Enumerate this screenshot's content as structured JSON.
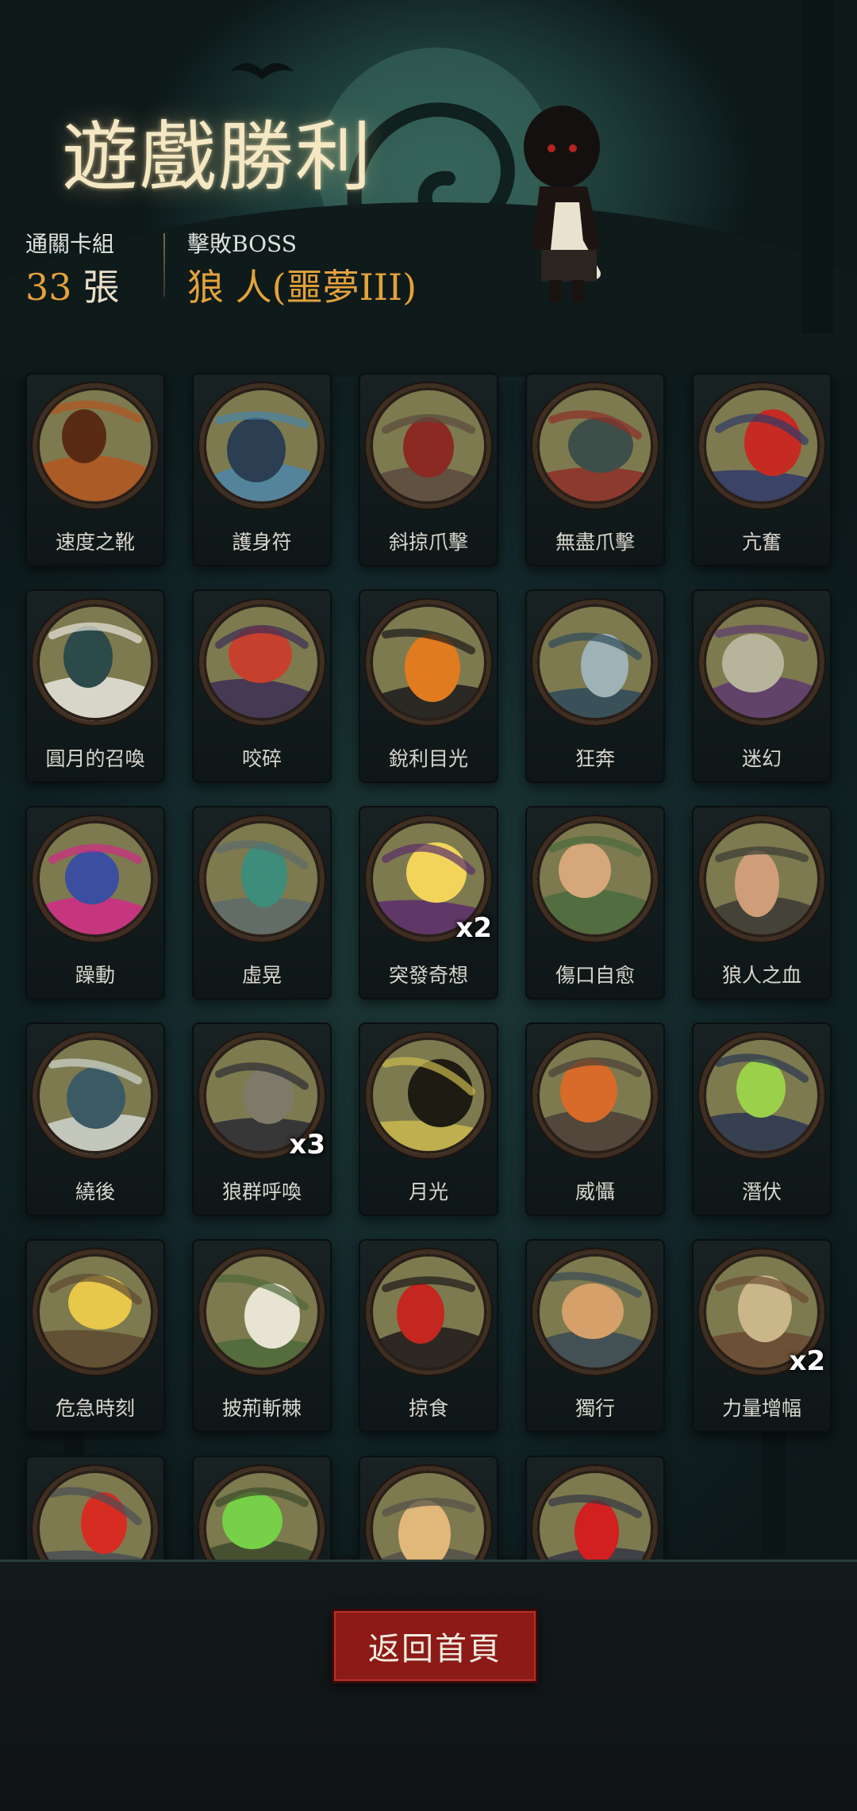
{
  "header": {
    "title": "遊戲勝利",
    "cleared_deck_label": "通關卡組",
    "cleared_deck_count": "33",
    "cleared_deck_unit": "張",
    "boss_label": "擊敗BOSS",
    "boss_name": "狼 人(噩夢III)"
  },
  "cards": [
    {
      "name": "速度之靴",
      "icon": "boot-icon"
    },
    {
      "name": "護身符",
      "icon": "amulet-shield-icon"
    },
    {
      "name": "斜掠爪擊",
      "icon": "werewolf-claw-icon"
    },
    {
      "name": "無盡爪擊",
      "icon": "claw-slash-icon"
    },
    {
      "name": "亢奮",
      "icon": "frenzy-werewolf-icon"
    },
    {
      "name": "圓月的召喚",
      "icon": "full-moon-forest-icon"
    },
    {
      "name": "咬碎",
      "icon": "bite-icon"
    },
    {
      "name": "銳利目光",
      "icon": "glowing-eyes-icon"
    },
    {
      "name": "狂奔",
      "icon": "running-wolf-icon"
    },
    {
      "name": "迷幻",
      "icon": "witch-icon"
    },
    {
      "name": "躁動",
      "icon": "restless-maw-icon"
    },
    {
      "name": "虛晃",
      "icon": "boxer-icon"
    },
    {
      "name": "突發奇想",
      "icon": "idea-bulb-icon",
      "count": "x2"
    },
    {
      "name": "傷口自愈",
      "icon": "healing-hand-icon"
    },
    {
      "name": "狼人之血",
      "icon": "bloody-arm-icon"
    },
    {
      "name": "繞後",
      "icon": "skull-ambush-icon"
    },
    {
      "name": "狼群呼喚",
      "icon": "wolf-pack-icon",
      "count": "x3"
    },
    {
      "name": "月光",
      "icon": "moon-howl-icon"
    },
    {
      "name": "威懾",
      "icon": "deterrence-icon"
    },
    {
      "name": "潛伏",
      "icon": "lurking-wolf-icon"
    },
    {
      "name": "危急時刻",
      "icon": "crisis-icon"
    },
    {
      "name": "披荊斬棘",
      "icon": "thorn-axe-icon"
    },
    {
      "name": "掠食",
      "icon": "predator-icon"
    },
    {
      "name": "獨行",
      "icon": "lone-boy-icon"
    },
    {
      "name": "力量增幅",
      "icon": "log-carry-icon",
      "count": "x2"
    },
    {
      "name": "",
      "icon": "roaring-werewolf-icon"
    },
    {
      "name": "",
      "icon": "poison-forest-icon"
    },
    {
      "name": "",
      "icon": "rock-fight-icon"
    },
    {
      "name": "",
      "icon": "red-eye-wolf-icon"
    }
  ],
  "colors": {
    "accent_orange": "#e3a23a",
    "button_red": "#8c1a17",
    "disc_olive": "#7d7a4f"
  },
  "footer": {
    "home_button_label": "返回首頁"
  }
}
